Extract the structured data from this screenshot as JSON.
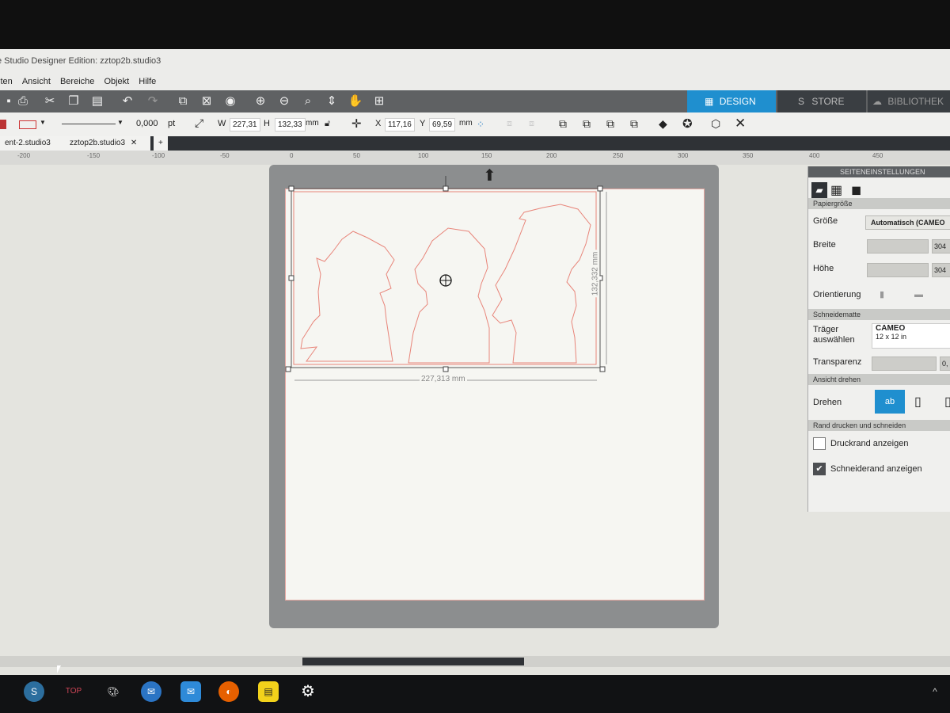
{
  "window": {
    "title": "e Studio Designer Edition: zztop2b.studio3"
  },
  "menu": [
    "iten",
    "Ansicht",
    "Bereiche",
    "Objekt",
    "Hilfe"
  ],
  "mode_tabs": {
    "design": "DESIGN",
    "store": "STORE",
    "library": "BIBLIOTHEK"
  },
  "line_settings": {
    "width": "0,000",
    "unit": "pt"
  },
  "size": {
    "w_label": "W",
    "w": "227,31",
    "h_label": "H",
    "h": "132,33",
    "unit": "mm"
  },
  "position": {
    "x_label": "X",
    "x": "117,16",
    "y_label": "Y",
    "y": "69,59",
    "unit": "mm"
  },
  "doc_tabs": [
    "ent-2.studio3",
    "zztop2b.studio3"
  ],
  "add_tab": "+",
  "ruler_labels": [
    "-200",
    "-150",
    "-100",
    "-50",
    "0",
    "50",
    "100",
    "150",
    "200",
    "250",
    "300",
    "350",
    "400",
    "450"
  ],
  "selection": {
    "width_label": "227,313 mm",
    "height_label": "132,332 mm"
  },
  "panel": {
    "title": "SEITENEINSTELLUNGEN",
    "paper_section": "Papiergröße",
    "size_label": "Größe",
    "size_value": "Automatisch (CAMEO",
    "width_label": "Breite",
    "width_value": "304",
    "height_label": "Höhe",
    "height_value": "304",
    "orientation_label": "Orientierung",
    "mat_section": "Schneidematte",
    "carrier_label_1": "Träger",
    "carrier_label_2": "auswählen",
    "carrier_value": "CAMEO",
    "carrier_size": "12 x 12 in",
    "transparency_label": "Transparenz",
    "transparency_value": "0,",
    "rotate_section": "Ansicht drehen",
    "rotate_label": "Drehen",
    "rotate_option": "ab",
    "print_section": "Rand drucken und schneiden",
    "print_border": "Druckrand anzeigen",
    "print_border_checked": false,
    "cut_border": "Schneiderand anzeigen",
    "cut_border_checked": true
  },
  "taskbar": [
    "silhouette-studio",
    "top-app",
    "paint-app",
    "thunderbird",
    "mail-app",
    "firefox",
    "sticky-notes",
    "settings"
  ],
  "colors": {
    "accent": "#1f8fcf",
    "cut_line": "#e8857a",
    "toolbar": "#5f6163"
  }
}
